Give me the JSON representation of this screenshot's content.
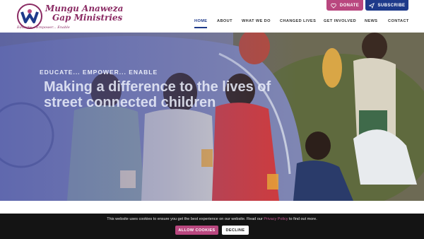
{
  "brand": {
    "logo_mark": "SpeKara",
    "name_line1": "Mungu Anaweza",
    "name_line2": "Gap Ministries",
    "tagline": "Educate... Empower... Enable"
  },
  "top_buttons": {
    "donate": "DONATE",
    "subscribe": "SUBSCRIBE"
  },
  "nav": {
    "items": [
      "HOME",
      "ABOUT",
      "WHAT WE DO",
      "CHANGED LIVES",
      "GET INVOLVED",
      "NEWS",
      "CONTACT"
    ],
    "active": "HOME"
  },
  "hero": {
    "eyebrow": "EDUCATE... EMPOWER... ENABLE",
    "headline": "Making a difference to the lives of street connected children"
  },
  "cookie": {
    "text_before": "This website uses cookies to ensure you get the best experience on our website. Read our ",
    "link": "Privacy Policy",
    "text_after": " to find out more.",
    "allow": "ALLOW COOKIES",
    "decline": "DECLINE"
  },
  "colors": {
    "brand_pink": "#b9477f",
    "brand_navy": "#1e3a8a",
    "logo_maroon": "#8a2a63"
  }
}
